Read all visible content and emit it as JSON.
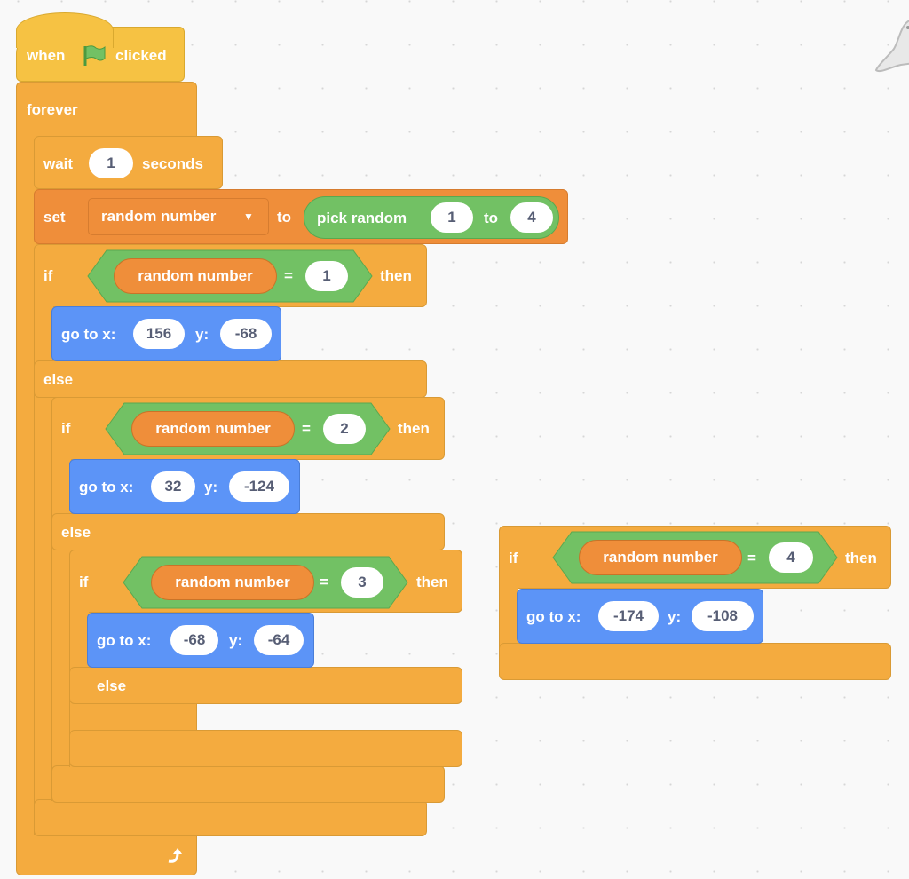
{
  "workspace": {
    "sprite_watermark": "seal-sprite-icon"
  },
  "colors": {
    "control": "#f4ab3f",
    "variables": "#ef8e3a",
    "motion": "#5c94f7",
    "operators": "#72c164",
    "events": "#f6c243"
  },
  "script_main": {
    "hat": {
      "when": "when",
      "clicked": "clicked",
      "icon": "green-flag-icon"
    },
    "forever": {
      "label": "forever",
      "loop_icon": "loop-arrow-icon"
    },
    "wait": {
      "label": "wait",
      "value": "1",
      "unit": "seconds"
    },
    "set": {
      "label": "set",
      "variable": "random number",
      "to": "to",
      "op_label": "pick random",
      "from": "1",
      "op_to": "to",
      "to_value": "4"
    },
    "if1": {
      "if": "if",
      "var": "random number",
      "eq": "=",
      "value": "1",
      "then": "then",
      "goto": {
        "label": "go to x:",
        "x": "156",
        "ylabel": "y:",
        "y": "-68"
      },
      "else": "else"
    },
    "if2": {
      "if": "if",
      "var": "random number",
      "eq": "=",
      "value": "2",
      "then": "then",
      "goto": {
        "label": "go to x:",
        "x": "32",
        "ylabel": "y:",
        "y": "-124"
      },
      "else": "else"
    },
    "if3": {
      "if": "if",
      "var": "random number",
      "eq": "=",
      "value": "3",
      "then": "then",
      "goto": {
        "label": "go to x:",
        "x": "-68",
        "ylabel": "y:",
        "y": "-64"
      },
      "else": "else"
    }
  },
  "script_loose": {
    "if4": {
      "if": "if",
      "var": "random number",
      "eq": "=",
      "value": "4",
      "then": "then",
      "goto": {
        "label": "go to x:",
        "x": "-174",
        "ylabel": "y:",
        "y": "-108"
      }
    }
  }
}
